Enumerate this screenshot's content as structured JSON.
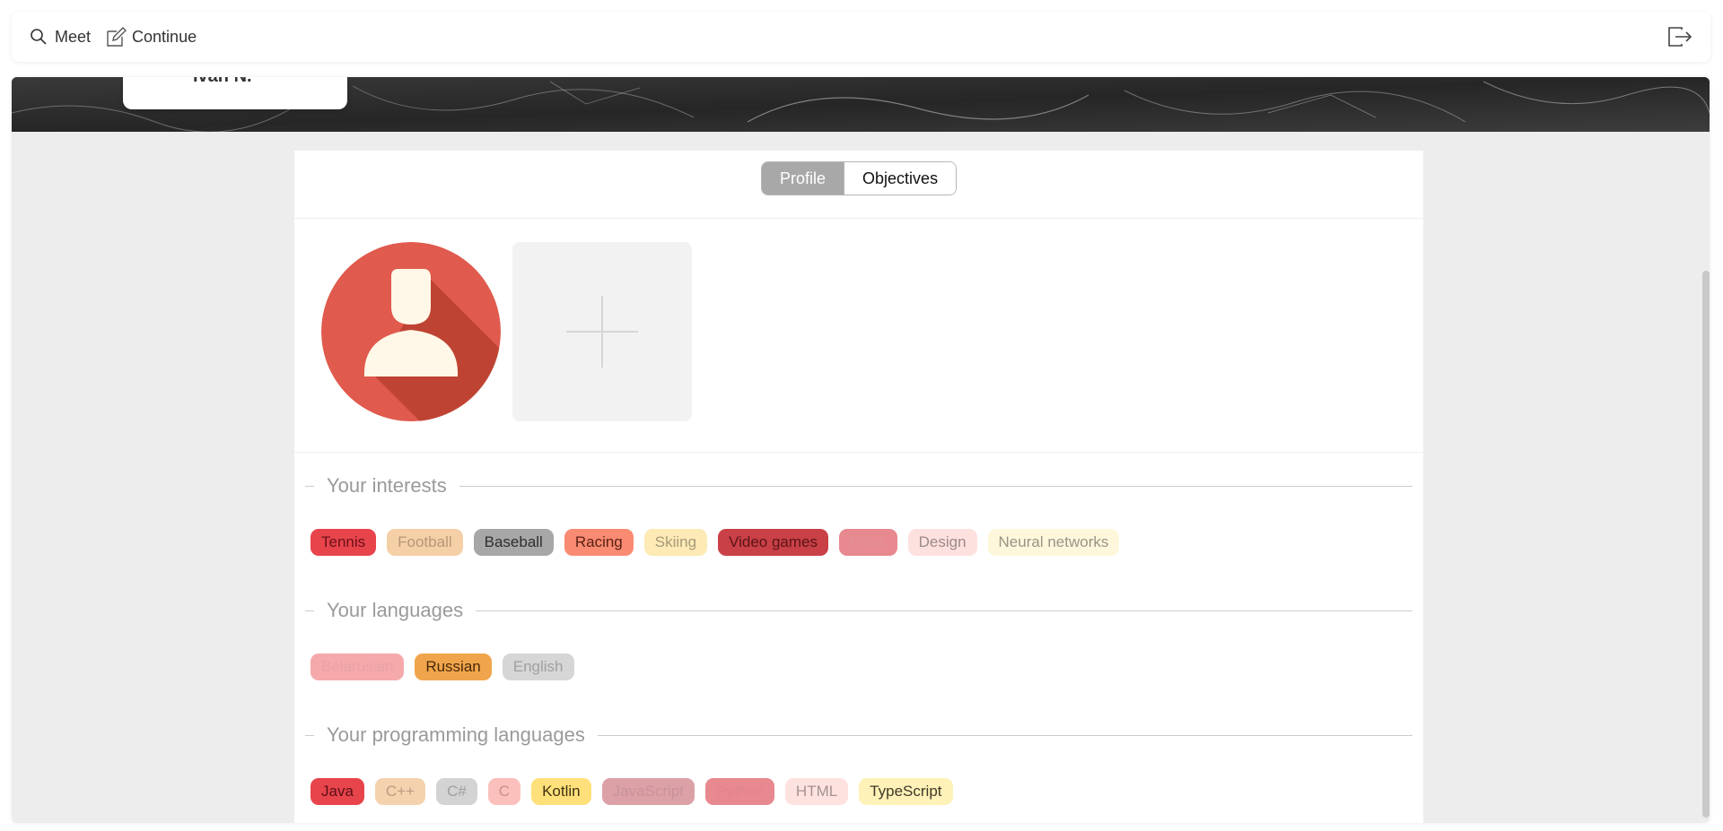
{
  "topbar": {
    "meet_label": "Meet",
    "continue_label": "Continue"
  },
  "tabs": [
    {
      "label": "Profile",
      "active": true
    },
    {
      "label": "Objectives",
      "active": false
    }
  ],
  "interests": {
    "title": "Your interests",
    "chips": [
      {
        "label": "Tennis",
        "bg": "#e8444c",
        "fg": "#6b1018"
      },
      {
        "label": "Football",
        "bg": "#f5cfa6",
        "fg": "#b8977a"
      },
      {
        "label": "Baseball",
        "bg": "#a7a7a7",
        "fg": "#2e2e2e"
      },
      {
        "label": "Racing",
        "bg": "#f98b72",
        "fg": "#5a2014"
      },
      {
        "label": "Skiing",
        "bg": "#fdeab5",
        "fg": "#a79a7a"
      },
      {
        "label": "Video games",
        "bg": "#c94046",
        "fg": "#5a1418"
      },
      {
        "label": "Films",
        "bg": "#e8888f",
        "fg": "#e39097"
      },
      {
        "label": "Design",
        "bg": "#fde1df",
        "fg": "#9c8a88"
      },
      {
        "label": "Neural networks",
        "bg": "#fff7dc",
        "fg": "#9a9486"
      }
    ]
  },
  "languages": {
    "title": "Your languages",
    "chips": [
      {
        "label": "Belarusian",
        "bg": "#f5a9ab",
        "fg": "#e9a2a5"
      },
      {
        "label": "Russian",
        "bg": "#f0a54c",
        "fg": "#4a2a08"
      },
      {
        "label": "English",
        "bg": "#d6d6d6",
        "fg": "#a0a0a0"
      }
    ]
  },
  "programming_languages": {
    "title": "Your programming languages",
    "chips": [
      {
        "label": "Java",
        "bg": "#e8444c",
        "fg": "#5a1014"
      },
      {
        "label": "C++",
        "bg": "#f5d2ae",
        "fg": "#b99c83"
      },
      {
        "label": "C#",
        "bg": "#d3d3d3",
        "fg": "#9f9f9f"
      },
      {
        "label": "C",
        "bg": "#fbc0bc",
        "fg": "#c9918d"
      },
      {
        "label": "Kotlin",
        "bg": "#ffe07a",
        "fg": "#3f3210"
      },
      {
        "label": "JavaScript",
        "bg": "#dba1a6",
        "fg": "#c79499"
      },
      {
        "label": "Python",
        "bg": "#e8888f",
        "fg": "#e3858c"
      },
      {
        "label": "HTML",
        "bg": "#fde2e0",
        "fg": "#a59391"
      },
      {
        "label": "TypeScript",
        "bg": "#fff2b8",
        "fg": "#3f3928"
      }
    ]
  },
  "colors": {
    "avatar_bg": "#e05a4e",
    "avatar_shadow": "#b8402f",
    "avatar_figure": "#fff8e8"
  }
}
